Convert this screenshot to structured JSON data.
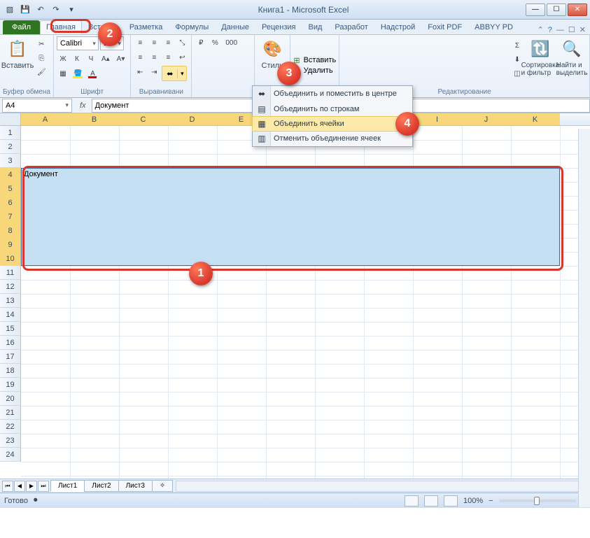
{
  "title": "Книга1  -  Microsoft Excel",
  "tabs": {
    "file": "Файл",
    "home": "Главная",
    "insert": "Вставка",
    "layout": "Разметка",
    "formulas": "Формулы",
    "data": "Данные",
    "review": "Рецензия",
    "view": "Вид",
    "dev": "Разработ",
    "addins": "Надстрой",
    "foxit": "Foxit PDF",
    "abbyy": "ABBYY PD"
  },
  "ribbon": {
    "clipboard": {
      "paste": "Вставить",
      "label": "Буфер обмена"
    },
    "font": {
      "family": "Calibri",
      "size": "14",
      "boldItalicUnderline": [
        "Ж",
        "К",
        "Ч"
      ],
      "label": "Шрифт"
    },
    "alignment": {
      "label": "Выравнивани"
    },
    "number": {
      "label": ""
    },
    "styles": {
      "label": "Стили"
    },
    "cells": {
      "insert": "Вставить",
      "delete": "Удалить",
      "label": ""
    },
    "editing": {
      "sort": "Сортировка и фильтр",
      "find": "Найти и выделить",
      "label": "Редактирование"
    }
  },
  "merge_menu": {
    "center": "Объединить и поместить в центре",
    "across": "Объединить по строкам",
    "merge": "Объединить ячейки",
    "unmerge": "Отменить объединение ячеек"
  },
  "formula": {
    "cellref": "A4",
    "fx": "fx",
    "value": "Документ"
  },
  "columns": [
    "A",
    "B",
    "C",
    "D",
    "E",
    "F",
    "G",
    "H",
    "I",
    "J",
    "K"
  ],
  "rows": [
    "1",
    "2",
    "3",
    "4",
    "5",
    "6",
    "7",
    "8",
    "9",
    "10",
    "11",
    "12",
    "13",
    "14",
    "15",
    "16",
    "17",
    "18",
    "19",
    "20",
    "21",
    "22",
    "23",
    "24"
  ],
  "cell_a4": "Документ",
  "sheets": {
    "s1": "Лист1",
    "s2": "Лист2",
    "s3": "Лист3"
  },
  "status": {
    "ready": "Готово",
    "zoom": "100%"
  },
  "callouts": {
    "c1": "1",
    "c2": "2",
    "c3": "3",
    "c4": "4"
  }
}
